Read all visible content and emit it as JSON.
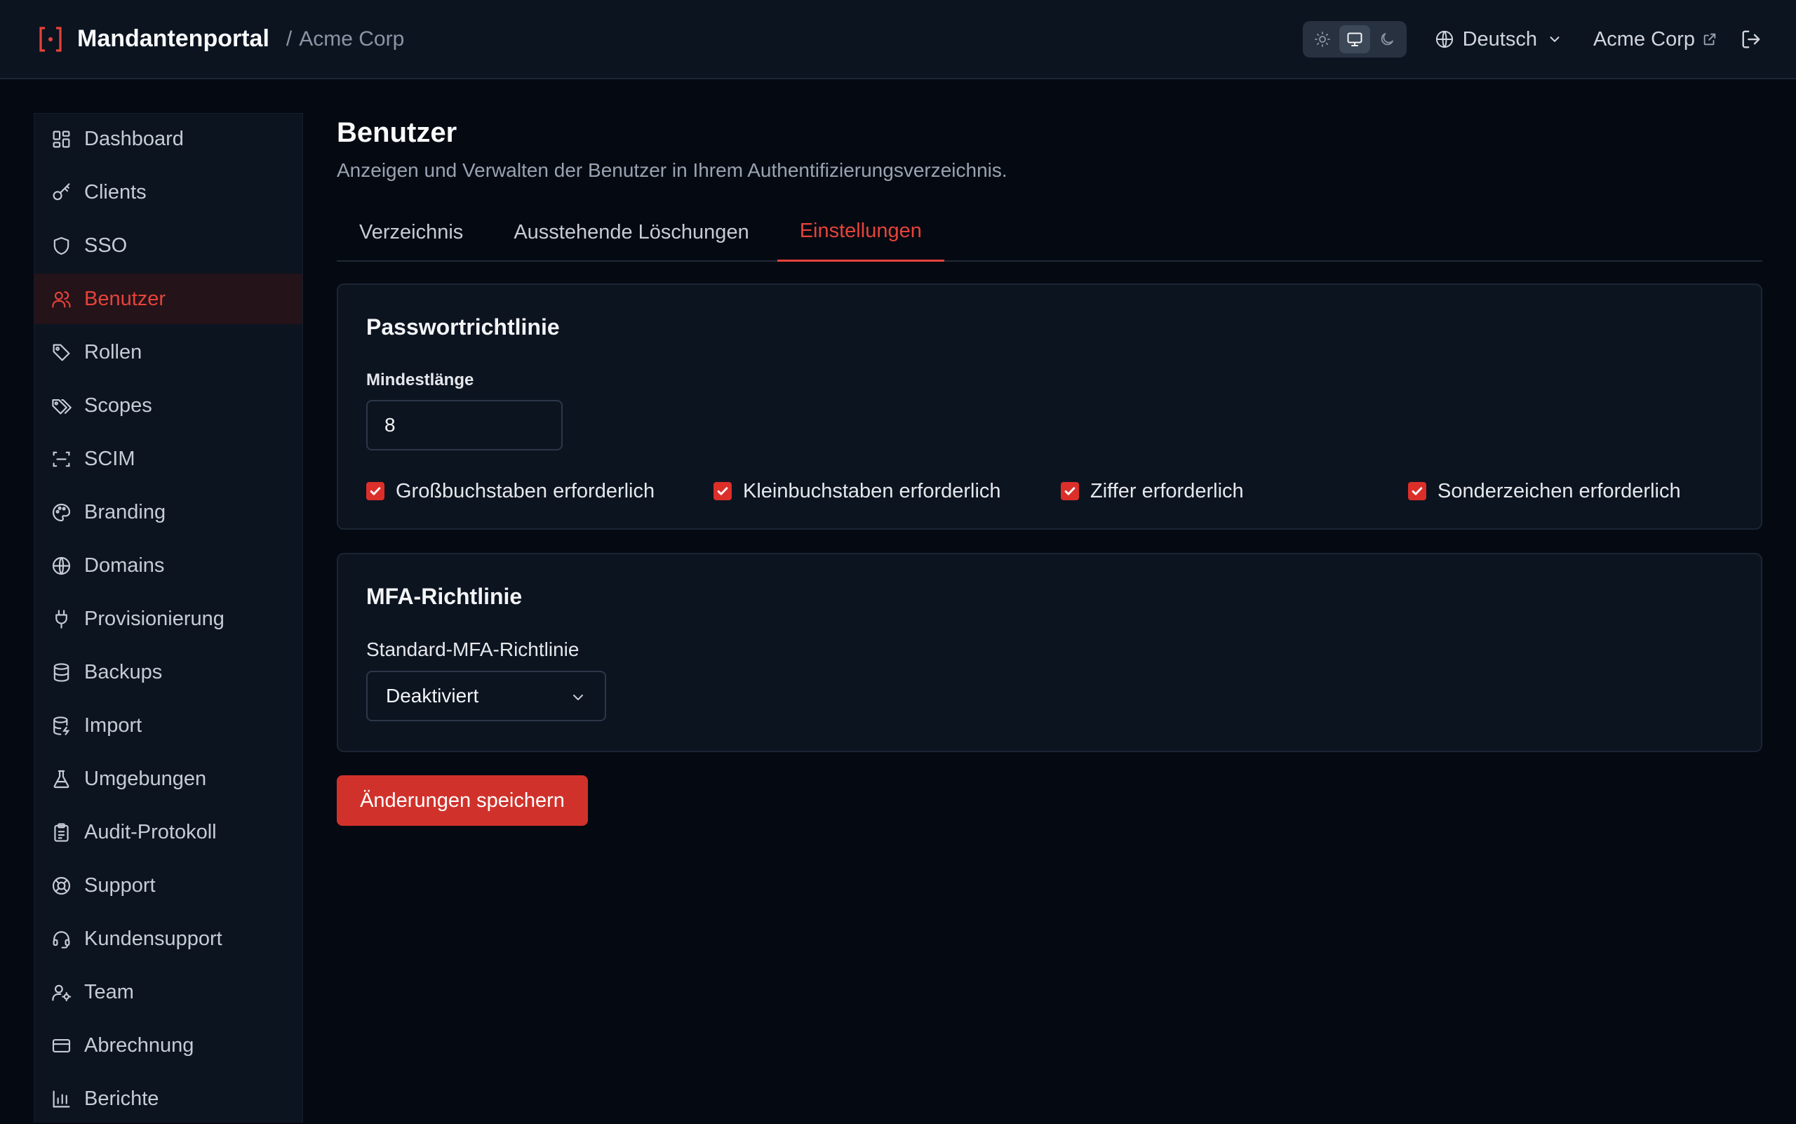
{
  "header": {
    "app_title": "Mandantenportal",
    "separator": "/",
    "tenant": "Acme Corp",
    "language": "Deutsch",
    "tenant_link": "Acme Corp",
    "theme_modes": [
      "light",
      "system",
      "dark"
    ],
    "active_theme": "system"
  },
  "sidebar": {
    "items": [
      {
        "label": "Dashboard",
        "icon": "dashboard-icon"
      },
      {
        "label": "Clients",
        "icon": "key-icon"
      },
      {
        "label": "SSO",
        "icon": "shield-icon"
      },
      {
        "label": "Benutzer",
        "icon": "users-icon",
        "active": true
      },
      {
        "label": "Rollen",
        "icon": "tag-icon"
      },
      {
        "label": "Scopes",
        "icon": "tags-icon"
      },
      {
        "label": "SCIM",
        "icon": "scan-icon"
      },
      {
        "label": "Branding",
        "icon": "palette-icon"
      },
      {
        "label": "Domains",
        "icon": "globe-icon"
      },
      {
        "label": "Provisionierung",
        "icon": "plug-icon"
      },
      {
        "label": "Backups",
        "icon": "database-icon"
      },
      {
        "label": "Import",
        "icon": "database-import-icon"
      },
      {
        "label": "Umgebungen",
        "icon": "flask-icon"
      },
      {
        "label": "Audit-Protokoll",
        "icon": "clipboard-icon"
      },
      {
        "label": "Support",
        "icon": "lifebuoy-icon"
      },
      {
        "label": "Kundensupport",
        "icon": "headset-icon"
      },
      {
        "label": "Team",
        "icon": "user-cog-icon"
      },
      {
        "label": "Abrechnung",
        "icon": "credit-card-icon"
      },
      {
        "label": "Berichte",
        "icon": "bar-chart-icon"
      }
    ]
  },
  "page": {
    "title": "Benutzer",
    "subtitle": "Anzeigen und Verwalten der Benutzer in Ihrem Authentifizierungsverzeichnis."
  },
  "tabs": [
    {
      "label": "Verzeichnis",
      "active": false
    },
    {
      "label": "Ausstehende Löschungen",
      "active": false
    },
    {
      "label": "Einstellungen",
      "active": true
    }
  ],
  "password_policy": {
    "title": "Passwortrichtlinie",
    "min_length_label": "Mindestlänge",
    "min_length_value": "8",
    "checkboxes": [
      {
        "label": "Großbuchstaben erforderlich",
        "checked": true
      },
      {
        "label": "Kleinbuchstaben erforderlich",
        "checked": true
      },
      {
        "label": "Ziffer erforderlich",
        "checked": true
      },
      {
        "label": "Sonderzeichen erforderlich",
        "checked": true
      }
    ]
  },
  "mfa_policy": {
    "title": "MFA-Richtlinie",
    "default_label": "Standard-MFA-Richtlinie",
    "default_value": "Deaktiviert"
  },
  "actions": {
    "save_label": "Änderungen speichern"
  },
  "colors": {
    "accent": "#d0322b",
    "active_nav_bg": "#241319",
    "background": "#050911",
    "panel": "#0c1420"
  }
}
